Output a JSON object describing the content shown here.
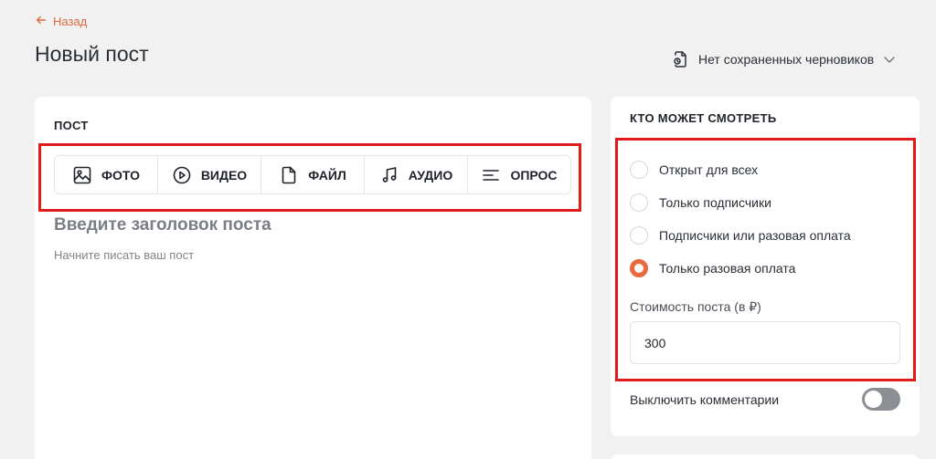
{
  "header": {
    "back_label": "Назад",
    "page_title": "Новый пост",
    "drafts_label": "Нет сохраненных черновиков"
  },
  "post": {
    "section_title": "ПОСТ",
    "media_buttons": [
      {
        "label": "ФОТО",
        "icon": "image-icon"
      },
      {
        "label": "ВИДЕО",
        "icon": "play-circle-icon"
      },
      {
        "label": "ФАЙЛ",
        "icon": "file-icon"
      },
      {
        "label": "АУДИО",
        "icon": "music-note-icon"
      },
      {
        "label": "ОПРОС",
        "icon": "poll-lines-icon"
      }
    ],
    "title_placeholder": "Введите заголовок поста",
    "body_placeholder": "Начните писать ваш пост"
  },
  "visibility": {
    "section_title": "КТО МОЖЕТ СМОТРЕТЬ",
    "options": [
      {
        "label": "Открыт для всех",
        "checked": false
      },
      {
        "label": "Только подписчики",
        "checked": false
      },
      {
        "label": "Подписчики или разовая оплата",
        "checked": false
      },
      {
        "label": "Только разовая оплата",
        "checked": true
      }
    ],
    "price_label": "Стоимость поста (в ₽)",
    "price_value": "300",
    "disable_comments_label": "Выключить комментарии",
    "disable_comments_on": false
  },
  "colors": {
    "accent": "#e86a3d",
    "highlight_box": "#e01b1b",
    "background": "#f1f1f1"
  }
}
